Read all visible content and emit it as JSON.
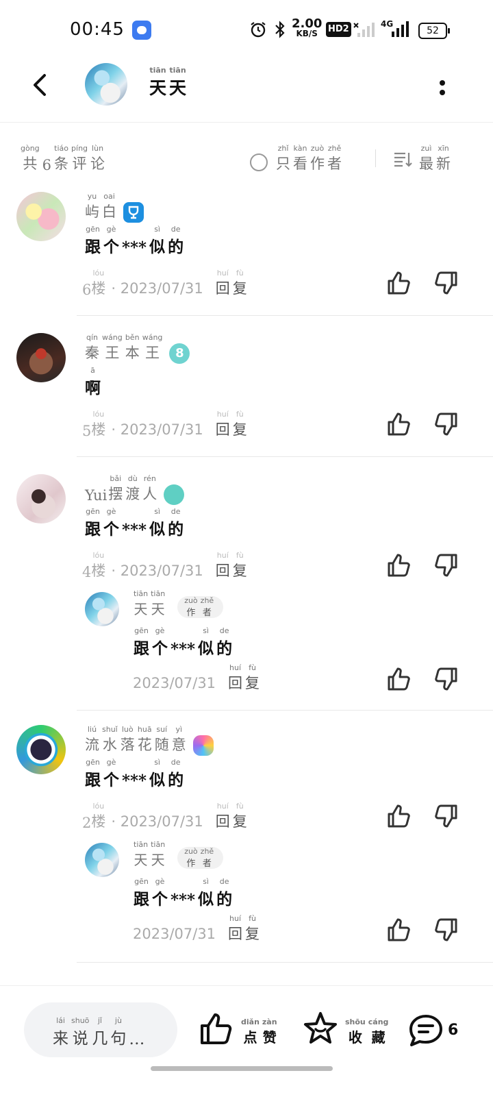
{
  "status_bar": {
    "time": "00:45",
    "speed_value": "2.00",
    "speed_unit": "KB/S",
    "hd_label": "HD2",
    "network": "4G",
    "battery": "52"
  },
  "header": {
    "title_chars": [
      {
        "py": "tiān",
        "hz": "天"
      },
      {
        "py": "tiān",
        "hz": "天"
      }
    ]
  },
  "filter": {
    "count_chars": [
      {
        "py": "gòng",
        "hz": "共"
      },
      {
        "py": "",
        "hz": "6"
      },
      {
        "py": "tiáo",
        "hz": "条"
      },
      {
        "py": "píng",
        "hz": "评"
      },
      {
        "py": "lùn",
        "hz": "论"
      }
    ],
    "author_only_chars": [
      {
        "py": "zhǐ",
        "hz": "只"
      },
      {
        "py": "kàn",
        "hz": "看"
      },
      {
        "py": "zuò",
        "hz": "作"
      },
      {
        "py": "zhě",
        "hz": "者"
      }
    ],
    "sort_chars": [
      {
        "py": "zuì",
        "hz": "最"
      },
      {
        "py": "xīn",
        "hz": "新"
      }
    ]
  },
  "comments": [
    {
      "name_chars": [
        {
          "py": "yu",
          "hz": "屿"
        },
        {
          "py": "oai",
          "hz": "白"
        }
      ],
      "badge": "trophy-badge",
      "text_chars": [
        {
          "py": "gēn",
          "hz": "跟"
        },
        {
          "py": "gè",
          "hz": "个"
        },
        {
          "py": "",
          "hz": "***"
        },
        {
          "py": "sì",
          "hz": "似"
        },
        {
          "py": "de",
          "hz": "的"
        }
      ],
      "floor_num": "6",
      "floor_chars": [
        {
          "py": "lóu",
          "hz": "楼"
        }
      ],
      "date": "· 2023/07/31",
      "reply_chars": [
        {
          "py": "huí",
          "hz": "回"
        },
        {
          "py": "fù",
          "hz": "复"
        }
      ]
    },
    {
      "name_chars": [
        {
          "py": "qín",
          "hz": "秦"
        },
        {
          "py": "wáng",
          "hz": "王"
        },
        {
          "py": "běn",
          "hz": "本"
        },
        {
          "py": "wáng",
          "hz": "王"
        }
      ],
      "badge": "level-8-badge",
      "badge_text": "8",
      "text_chars": [
        {
          "py": "ā",
          "hz": "啊"
        }
      ],
      "floor_num": "5",
      "floor_chars": [
        {
          "py": "lóu",
          "hz": "楼"
        }
      ],
      "date": "· 2023/07/31",
      "reply_chars": [
        {
          "py": "huí",
          "hz": "回"
        },
        {
          "py": "fù",
          "hz": "复"
        }
      ]
    },
    {
      "name_prefix": "Yui",
      "name_chars": [
        {
          "py": "bǎi",
          "hz": "摆"
        },
        {
          "py": "dù",
          "hz": "渡"
        },
        {
          "py": "rén",
          "hz": "人"
        }
      ],
      "badge": "teal-badge",
      "text_chars": [
        {
          "py": "gēn",
          "hz": "跟"
        },
        {
          "py": "gè",
          "hz": "个"
        },
        {
          "py": "",
          "hz": "***"
        },
        {
          "py": "sì",
          "hz": "似"
        },
        {
          "py": "de",
          "hz": "的"
        }
      ],
      "floor_num": "4",
      "floor_chars": [
        {
          "py": "lóu",
          "hz": "楼"
        }
      ],
      "date": "· 2023/07/31",
      "reply_chars": [
        {
          "py": "huí",
          "hz": "回"
        },
        {
          "py": "fù",
          "hz": "复"
        }
      ],
      "sub_reply": {
        "name_chars": [
          {
            "py": "tiān",
            "hz": "天"
          },
          {
            "py": "tiān",
            "hz": "天"
          }
        ],
        "tag_chars": [
          {
            "py": "zuò",
            "hz": "作"
          },
          {
            "py": "zhě",
            "hz": "者"
          }
        ],
        "text_chars": [
          {
            "py": "gēn",
            "hz": "跟"
          },
          {
            "py": "gè",
            "hz": "个"
          },
          {
            "py": "",
            "hz": "***"
          },
          {
            "py": "sì",
            "hz": "似"
          },
          {
            "py": "de",
            "hz": "的"
          }
        ],
        "date": "2023/07/31",
        "reply_chars": [
          {
            "py": "huí",
            "hz": "回"
          },
          {
            "py": "fù",
            "hz": "复"
          }
        ]
      }
    },
    {
      "name_chars": [
        {
          "py": "liú",
          "hz": "流"
        },
        {
          "py": "shuǐ",
          "hz": "水"
        },
        {
          "py": "luò",
          "hz": "落"
        },
        {
          "py": "huā",
          "hz": "花"
        },
        {
          "py": "suí",
          "hz": "随"
        },
        {
          "py": "yì",
          "hz": "意"
        }
      ],
      "badge": "colorful-badge",
      "text_chars": [
        {
          "py": "gēn",
          "hz": "跟"
        },
        {
          "py": "gè",
          "hz": "个"
        },
        {
          "py": "",
          "hz": "***"
        },
        {
          "py": "sì",
          "hz": "似"
        },
        {
          "py": "de",
          "hz": "的"
        }
      ],
      "floor_num": "2",
      "floor_chars": [
        {
          "py": "lóu",
          "hz": "楼"
        }
      ],
      "date": "· 2023/07/31",
      "reply_chars": [
        {
          "py": "huí",
          "hz": "回"
        },
        {
          "py": "fù",
          "hz": "复"
        }
      ],
      "sub_reply": {
        "name_chars": [
          {
            "py": "tiān",
            "hz": "天"
          },
          {
            "py": "tiān",
            "hz": "天"
          }
        ],
        "tag_chars": [
          {
            "py": "zuò",
            "hz": "作"
          },
          {
            "py": "zhě",
            "hz": "者"
          }
        ],
        "text_chars": [
          {
            "py": "gēn",
            "hz": "跟"
          },
          {
            "py": "gè",
            "hz": "个"
          },
          {
            "py": "",
            "hz": "***"
          },
          {
            "py": "sì",
            "hz": "似"
          },
          {
            "py": "de",
            "hz": "的"
          }
        ],
        "date": "2023/07/31",
        "reply_chars": [
          {
            "py": "huí",
            "hz": "回"
          },
          {
            "py": "fù",
            "hz": "复"
          }
        ]
      }
    }
  ],
  "bottom_bar": {
    "input_chars": [
      {
        "py": "lái",
        "hz": "来"
      },
      {
        "py": "shuō",
        "hz": "说"
      },
      {
        "py": "jǐ",
        "hz": "几"
      },
      {
        "py": "jù",
        "hz": "句"
      },
      {
        "py": "",
        "hz": "…"
      }
    ],
    "like_chars": [
      {
        "py": "diǎn",
        "hz": "点"
      },
      {
        "py": "zàn",
        "hz": "赞"
      }
    ],
    "fav_chars": [
      {
        "py": "shōu",
        "hz": "收"
      },
      {
        "py": "cáng",
        "hz": "藏"
      }
    ],
    "comment_count": "6"
  },
  "colors": {
    "accent_blue": "#1d8fe0",
    "text_gray": "#777777",
    "text_light": "#aaaaaa"
  }
}
